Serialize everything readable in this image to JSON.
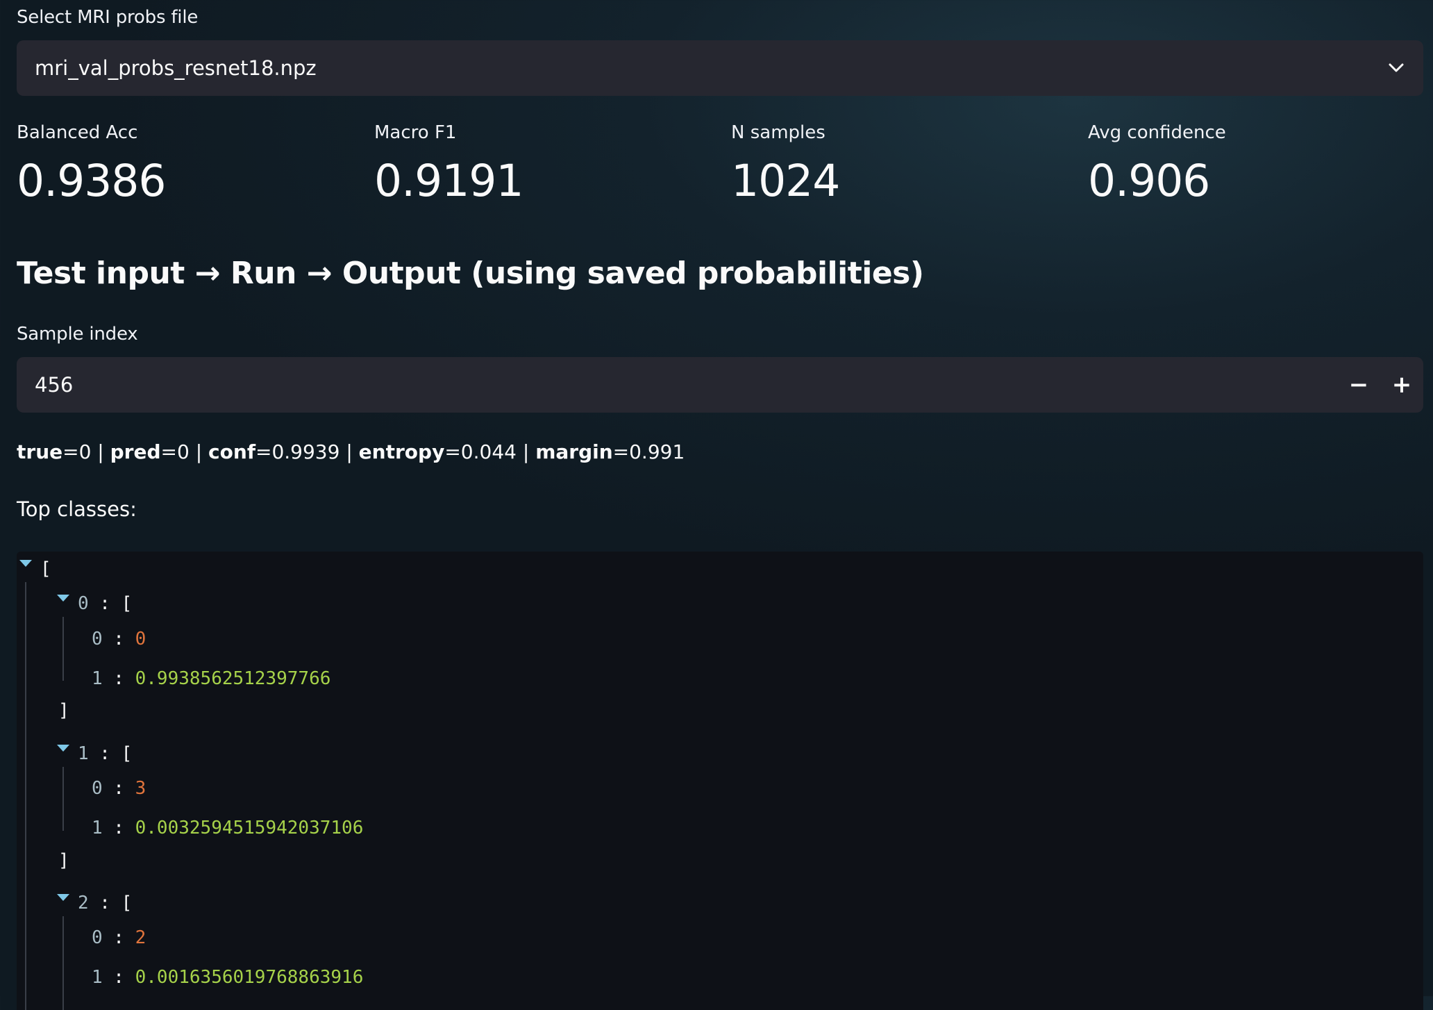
{
  "file_select": {
    "label": "Select MRI probs file",
    "value": "mri_val_probs_resnet18.npz"
  },
  "metrics": [
    {
      "label": "Balanced Acc",
      "value": "0.9386"
    },
    {
      "label": "Macro F1",
      "value": "0.9191"
    },
    {
      "label": "N samples",
      "value": "1024"
    },
    {
      "label": "Avg confidence",
      "value": "0.906"
    }
  ],
  "section_heading": "Test input → Run → Output (using saved probabilities)",
  "sample_index": {
    "label": "Sample index",
    "value": "456",
    "decrement": "−",
    "increment": "+"
  },
  "info": {
    "true_label": "true",
    "true_value": "=0 | ",
    "pred_label": "pred",
    "pred_value": "=0 | ",
    "conf_label": "conf",
    "conf_value": "=0.9939 | ",
    "entropy_label": "entropy",
    "entropy_value": "=0.044 | ",
    "margin_label": "margin",
    "margin_value": "=0.991"
  },
  "top_classes_label": "Top classes:",
  "json_viewer": {
    "open_bracket": "[",
    "close_bracket": "]",
    "sep": " : ",
    "entries": [
      {
        "index": "0",
        "k0": "0",
        "v0": "0",
        "k1": "1",
        "v1": "0.9938562512397766"
      },
      {
        "index": "1",
        "k0": "0",
        "v0": "3",
        "k1": "1",
        "v1": "0.0032594515942037106"
      },
      {
        "index": "2",
        "k0": "0",
        "v0": "2",
        "k1": "1",
        "v1": "0.0016356019768863916"
      }
    ]
  },
  "colors": {
    "background": "#0f1a22",
    "input_bg": "#262730",
    "json_bg": "#0e1117",
    "int_color": "#e0743c",
    "float_color": "#a6d24a",
    "toggle_color": "#7fc8e8"
  },
  "icons": {
    "select_chevron": "chevron-down-icon",
    "tree_toggle": "caret-down-icon"
  }
}
